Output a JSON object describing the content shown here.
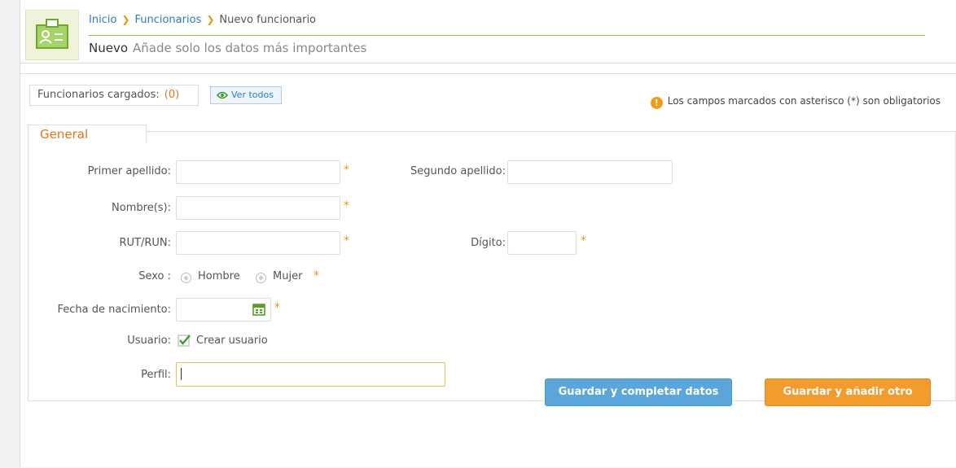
{
  "breadcrumb": {
    "home": "Inicio",
    "section": "Funcionarios",
    "current": "Nuevo funcionario"
  },
  "header": {
    "title": "Nuevo",
    "subtitle": "Añade solo los datos más importantes",
    "icon": "id-card-icon"
  },
  "toolbar": {
    "loaded_label": "Funcionarios cargados:",
    "loaded_count": "(0)",
    "view_all_label": "Ver todos"
  },
  "notice": {
    "text": "Los campos marcados con asterisco (*) son obligatorios",
    "icon": "warning-icon"
  },
  "form": {
    "section_title": "General",
    "first_surname_label": "Primer apellido:",
    "second_surname_label": "Segundo apellido:",
    "names_label": "Nombre(s):",
    "rut_label": "RUT/RUN:",
    "digit_label": "Dígito:",
    "sex_label": "Sexo :",
    "sex_male": "Hombre",
    "sex_female": "Mujer",
    "birthdate_label": "Fecha de nacimiento:",
    "user_label": "Usuario:",
    "create_user_label": "Crear usuario",
    "create_user_checked": true,
    "profile_label": "Perfil:",
    "required_mark": "*"
  },
  "actions": {
    "save_complete": "Guardar y completar datos",
    "save_add_another": "Guardar y añadir otro"
  },
  "colors": {
    "accent_orange": "#e8731a",
    "link_blue": "#2f7dc3",
    "green_rule": "#8cc63f",
    "button_blue": "#5aa6dc",
    "button_orange": "#f39b2d"
  }
}
